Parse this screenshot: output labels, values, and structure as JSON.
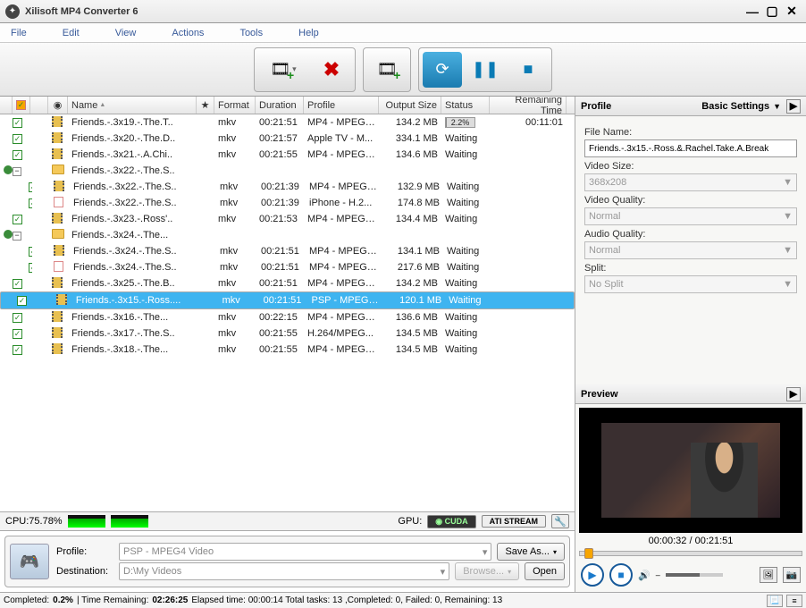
{
  "window": {
    "title": "Xilisoft MP4 Converter 6"
  },
  "menu": [
    "File",
    "Edit",
    "View",
    "Actions",
    "Tools",
    "Help"
  ],
  "columns": {
    "name": "Name",
    "format": "Format",
    "duration": "Duration",
    "profile": "Profile",
    "output": "Output Size",
    "status": "Status",
    "remaining": "Remaining Time"
  },
  "rows": [
    {
      "indent": 0,
      "chk": true,
      "icon": "film",
      "name": "Friends.-.3x19.-.The.T..",
      "fmt": "mkv",
      "dur": "00:21:51",
      "prof": "MP4 - MPEG-...",
      "out": "134.2 MB",
      "stat": "2.2%",
      "rem": "00:11:01",
      "progress": 2.2
    },
    {
      "indent": 0,
      "chk": true,
      "icon": "film",
      "name": "Friends.-.3x20.-.The.D..",
      "fmt": "mkv",
      "dur": "00:21:57",
      "prof": "Apple TV - M...",
      "out": "334.1 MB",
      "stat": "Waiting",
      "rem": ""
    },
    {
      "indent": 0,
      "chk": true,
      "icon": "film",
      "name": "Friends.-.3x21.-.A.Chi..",
      "fmt": "mkv",
      "dur": "00:21:55",
      "prof": "MP4 - MPEG-...",
      "out": "134.6 MB",
      "stat": "Waiting",
      "rem": ""
    },
    {
      "indent": 0,
      "toggle": true,
      "icon": "folder",
      "name": "Friends.-.3x22.-.The.S..",
      "fmt": "",
      "dur": "",
      "prof": "",
      "out": "",
      "stat": "",
      "rem": ""
    },
    {
      "indent": 1,
      "chk": true,
      "icon": "film",
      "name": "Friends.-.3x22.-.The.S..",
      "fmt": "mkv",
      "dur": "00:21:39",
      "prof": "MP4 - MPEG-...",
      "out": "132.9 MB",
      "stat": "Waiting",
      "rem": ""
    },
    {
      "indent": 1,
      "chk": true,
      "icon": "doc",
      "name": "Friends.-.3x22.-.The.S..",
      "fmt": "mkv",
      "dur": "00:21:39",
      "prof": "iPhone - H.2...",
      "out": "174.8 MB",
      "stat": "Waiting",
      "rem": ""
    },
    {
      "indent": 0,
      "chk": true,
      "icon": "film",
      "name": "Friends.-.3x23.-.Ross'..",
      "fmt": "mkv",
      "dur": "00:21:53",
      "prof": "MP4 - MPEG-...",
      "out": "134.4 MB",
      "stat": "Waiting",
      "rem": ""
    },
    {
      "indent": 0,
      "toggle": true,
      "icon": "folder",
      "name": "Friends.-.3x24.-.The...",
      "fmt": "",
      "dur": "",
      "prof": "",
      "out": "",
      "stat": "",
      "rem": ""
    },
    {
      "indent": 1,
      "chk": true,
      "icon": "film",
      "name": "Friends.-.3x24.-.The.S..",
      "fmt": "mkv",
      "dur": "00:21:51",
      "prof": "MP4 - MPEG-...",
      "out": "134.1 MB",
      "stat": "Waiting",
      "rem": ""
    },
    {
      "indent": 1,
      "chk": true,
      "icon": "doc",
      "name": "Friends.-.3x24.-.The.S..",
      "fmt": "mkv",
      "dur": "00:21:51",
      "prof": "MP4 - MPEG-...",
      "out": "217.6 MB",
      "stat": "Waiting",
      "rem": ""
    },
    {
      "indent": 0,
      "chk": true,
      "icon": "film",
      "name": "Friends.-.3x25.-.The.B..",
      "fmt": "mkv",
      "dur": "00:21:51",
      "prof": "MP4 - MPEG-...",
      "out": "134.2 MB",
      "stat": "Waiting",
      "rem": ""
    },
    {
      "indent": 0,
      "chk": true,
      "icon": "film",
      "name": "Friends.-.3x15.-.Ross....",
      "fmt": "mkv",
      "dur": "00:21:51",
      "prof": "PSP - MPEG4...",
      "out": "120.1 MB",
      "stat": "Waiting",
      "rem": "",
      "selected": true
    },
    {
      "indent": 0,
      "chk": true,
      "icon": "film",
      "name": "Friends.-.3x16.-.The...",
      "fmt": "mkv",
      "dur": "00:22:15",
      "prof": "MP4 - MPEG-...",
      "out": "136.6 MB",
      "stat": "Waiting",
      "rem": ""
    },
    {
      "indent": 0,
      "chk": true,
      "icon": "film",
      "name": "Friends.-.3x17.-.The.S..",
      "fmt": "mkv",
      "dur": "00:21:55",
      "prof": "H.264/MPEG...",
      "out": "134.5 MB",
      "stat": "Waiting",
      "rem": ""
    },
    {
      "indent": 0,
      "chk": true,
      "icon": "film",
      "name": "Friends.-.3x18.-.The...",
      "fmt": "mkv",
      "dur": "00:21:55",
      "prof": "MP4 - MPEG-...",
      "out": "134.5 MB",
      "stat": "Waiting",
      "rem": ""
    }
  ],
  "cpu": {
    "label": "CPU:75.78%"
  },
  "gpu": {
    "label": "GPU:",
    "cuda": "CUDA",
    "ati": "ATI STREAM"
  },
  "bottom": {
    "profile_label": "Profile:",
    "profile_value": "PSP - MPEG4 Video",
    "dest_label": "Destination:",
    "dest_value": "D:\\My Videos",
    "saveas": "Save As...",
    "browse": "Browse...",
    "open": "Open"
  },
  "status": {
    "text1": "Completed: ",
    "v1": "0.2%",
    "text2": " | Time Remaining: ",
    "v2": "02:26:25",
    "text3": "Elapsed time: 00:00:14 Total tasks: 13 ,Completed: 0, Failed: 0, Remaining: 13"
  },
  "profile": {
    "head": "Profile",
    "settings": "Basic Settings",
    "filename_label": "File Name:",
    "filename": "Friends.-.3x15.-.Ross.&.Rachel.Take.A.Break",
    "videosize_label": "Video Size:",
    "videosize": "368x208",
    "vquality_label": "Video Quality:",
    "vquality": "Normal",
    "aquality_label": "Audio Quality:",
    "aquality": "Normal",
    "split_label": "Split:",
    "split": "No Split"
  },
  "preview": {
    "head": "Preview",
    "time": "00:00:32 / 00:21:51",
    "vol": "🔊"
  }
}
